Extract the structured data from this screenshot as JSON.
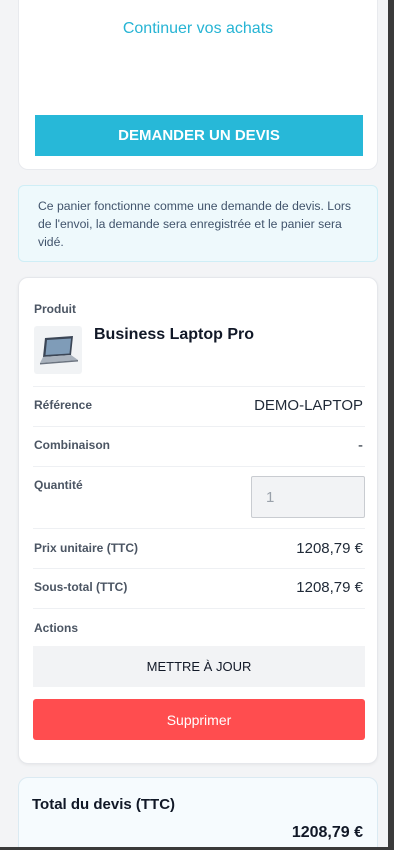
{
  "top_card": {
    "continue_label": "Continuer vos achats",
    "quote_button_label": "DEMANDER UN DEVIS"
  },
  "info": {
    "text": "Ce panier fonctionne comme une demande de devis. Lors de l'envoi, la demande sera enregistrée et le panier sera vidé."
  },
  "item": {
    "product_label": "Produit",
    "product_name": "Business Laptop Pro",
    "thumbnail_icon": "laptop-icon",
    "reference_label": "Référence",
    "reference_value": "DEMO-LAPTOP",
    "combination_label": "Combinaison",
    "combination_value": "-",
    "quantity_label": "Quantité",
    "quantity_value": "1",
    "unit_price_label": "Prix unitaire (TTC)",
    "unit_price_value": "1208,79 €",
    "subtotal_label": "Sous-total (TTC)",
    "subtotal_value": "1208,79 €",
    "actions_label": "Actions",
    "update_button_label": "METTRE À JOUR",
    "delete_button_label": "Supprimer"
  },
  "total": {
    "label": "Total du devis (TTC)",
    "value": "1208,79 €"
  },
  "colors": {
    "accent": "#27b8d8",
    "danger": "#ff4d4f",
    "info_bg": "#eef9fc"
  }
}
